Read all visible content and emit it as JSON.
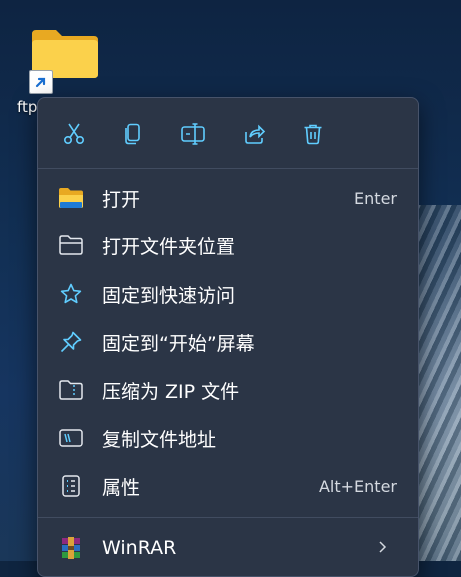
{
  "desktop": {
    "folder_label": "ftp",
    "folder_icon": "folder-icon",
    "shortcut_icon": "shortcut-arrow-icon"
  },
  "menu": {
    "quick_actions": [
      {
        "name": "cut",
        "icon": "scissors-icon"
      },
      {
        "name": "copy",
        "icon": "copy-icon"
      },
      {
        "name": "rename",
        "icon": "rename-icon"
      },
      {
        "name": "share",
        "icon": "share-icon"
      },
      {
        "name": "delete",
        "icon": "trash-icon"
      }
    ],
    "items": [
      {
        "label": "打开",
        "shortcut": "Enter",
        "icon": "folder-open-icon"
      },
      {
        "label": "打开文件夹位置",
        "shortcut": "",
        "icon": "folder-outline-icon"
      },
      {
        "label": "固定到快速访问",
        "shortcut": "",
        "icon": "star-icon"
      },
      {
        "label": "固定到“开始”屏幕",
        "shortcut": "",
        "icon": "pin-icon"
      },
      {
        "label": "压缩为 ZIP 文件",
        "shortcut": "",
        "icon": "zip-icon"
      },
      {
        "label": "复制文件地址",
        "shortcut": "",
        "icon": "path-icon"
      },
      {
        "label": "属性",
        "shortcut": "Alt+Enter",
        "icon": "properties-icon"
      }
    ],
    "extra_items": [
      {
        "label": "WinRAR",
        "icon": "winrar-icon",
        "has_submenu": true
      }
    ]
  },
  "colors": {
    "accent_icon": "#60cdff",
    "menu_bg": "#2b3546",
    "text": "#ffffff",
    "folder_yellow": "#f8c93f"
  }
}
